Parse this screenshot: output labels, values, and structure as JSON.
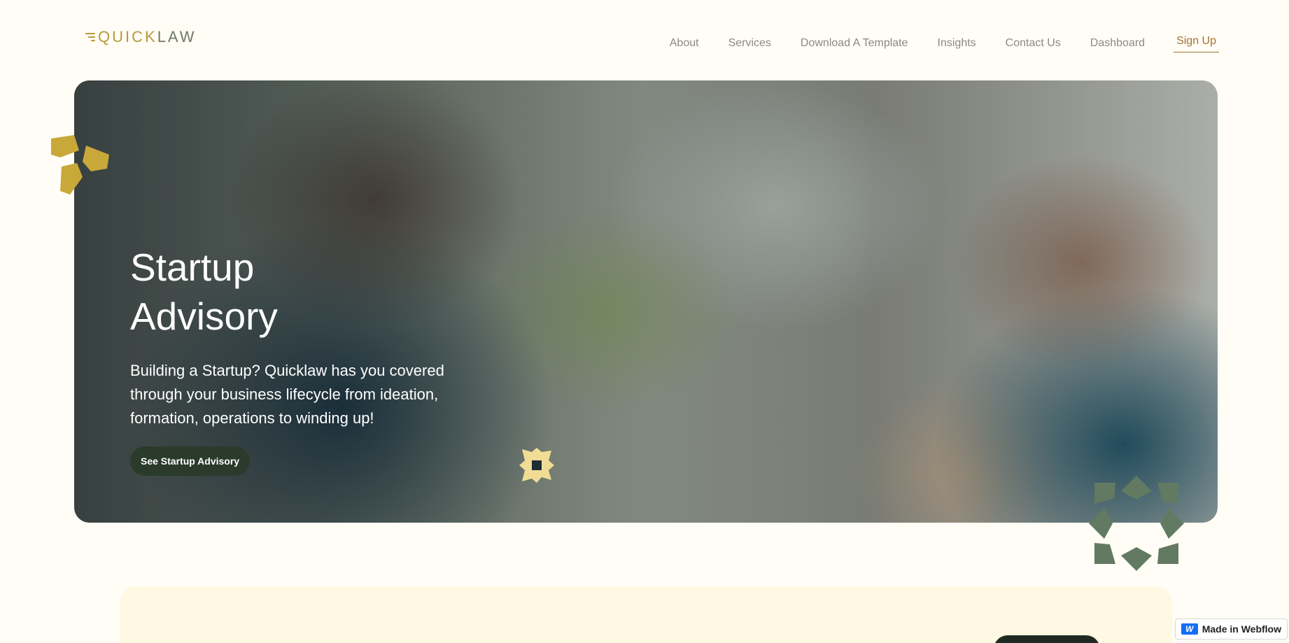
{
  "brand": {
    "q": "Q",
    "uick": "UICK",
    "law": "LAW"
  },
  "nav": {
    "items": [
      {
        "label": "About"
      },
      {
        "label": "Services"
      },
      {
        "label": "Download A Template"
      },
      {
        "label": "Insights"
      },
      {
        "label": "Contact Us"
      },
      {
        "label": "Dashboard"
      }
    ],
    "signup": "Sign Up"
  },
  "hero": {
    "title": "Startup Advisory",
    "description": "Building a Startup? Quicklaw has you covered through your business lifecycle from ideation, formation, operations to winding up!",
    "button": "See Startup Advisory"
  },
  "badge": {
    "label": "Made in Webflow",
    "icon": "webflow-icon"
  },
  "colors": {
    "background": "#fffdf5",
    "gold": "#c9a83a",
    "green": "#627a62",
    "dark_button": "#2a3b2c",
    "signup": "#a07434"
  }
}
